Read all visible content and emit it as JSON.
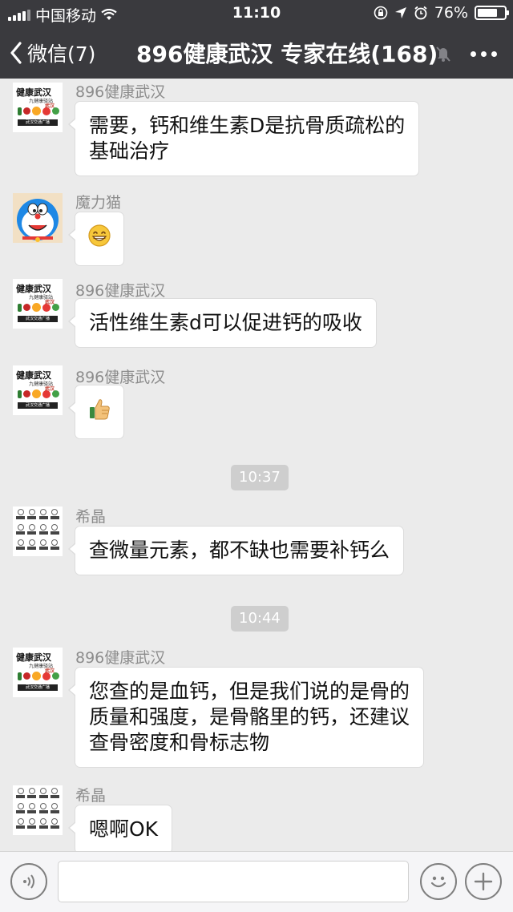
{
  "status_bar": {
    "carrier": "中国移动",
    "time": "11:10",
    "battery_percent": "76%",
    "battery_level": 0.76
  },
  "nav": {
    "back_label": "微信(7)",
    "title": "896健康武汉 专家在线(168)"
  },
  "messages": [
    {
      "sender": "896健康武汉",
      "avatar": "health-logo",
      "lines": [
        "需要，钙和维生素D是抗骨质疏松的",
        "基础治疗"
      ]
    },
    {
      "sender": "魔力猫",
      "avatar": "doraemon",
      "emoji": "😁"
    },
    {
      "sender": "896健康武汉",
      "avatar": "health-logo",
      "lines": [
        "活性维生素d可以促进钙的吸收"
      ]
    },
    {
      "sender": "896健康武汉",
      "avatar": "health-logo",
      "emoji": "👍"
    },
    {
      "sender": "希晶",
      "avatar": "grid-icons",
      "lines": [
        "查微量元素，都不缺也需要补钙么"
      ]
    },
    {
      "sender": "896健康武汉",
      "avatar": "health-logo",
      "lines": [
        "您查的是血钙，但是我们说的是骨的",
        "质量和强度，是骨骼里的钙，还建议",
        "查骨密度和骨标志物"
      ]
    },
    {
      "sender": "希晶",
      "avatar": "grid-icons",
      "lines": [
        "嗯啊OK"
      ]
    }
  ],
  "timestamps": [
    "10:37",
    "10:44"
  ],
  "logo_text": {
    "name": "健康武汉",
    "sub": "九健康驿站",
    "tag": "武汉",
    "band": "武汉交通广播"
  },
  "input": {
    "value": ""
  },
  "icons": {
    "voice": "voice-icon",
    "emoji": "emoji-icon",
    "add": "plus-icon",
    "mute": "mute-bell-icon",
    "more": "more-icon",
    "back": "chevron-left-icon"
  },
  "colors": {
    "bar": "#3a3a3e",
    "background": "#ebebeb",
    "bubble": "#ffffff",
    "timestamp": "#cecece"
  }
}
